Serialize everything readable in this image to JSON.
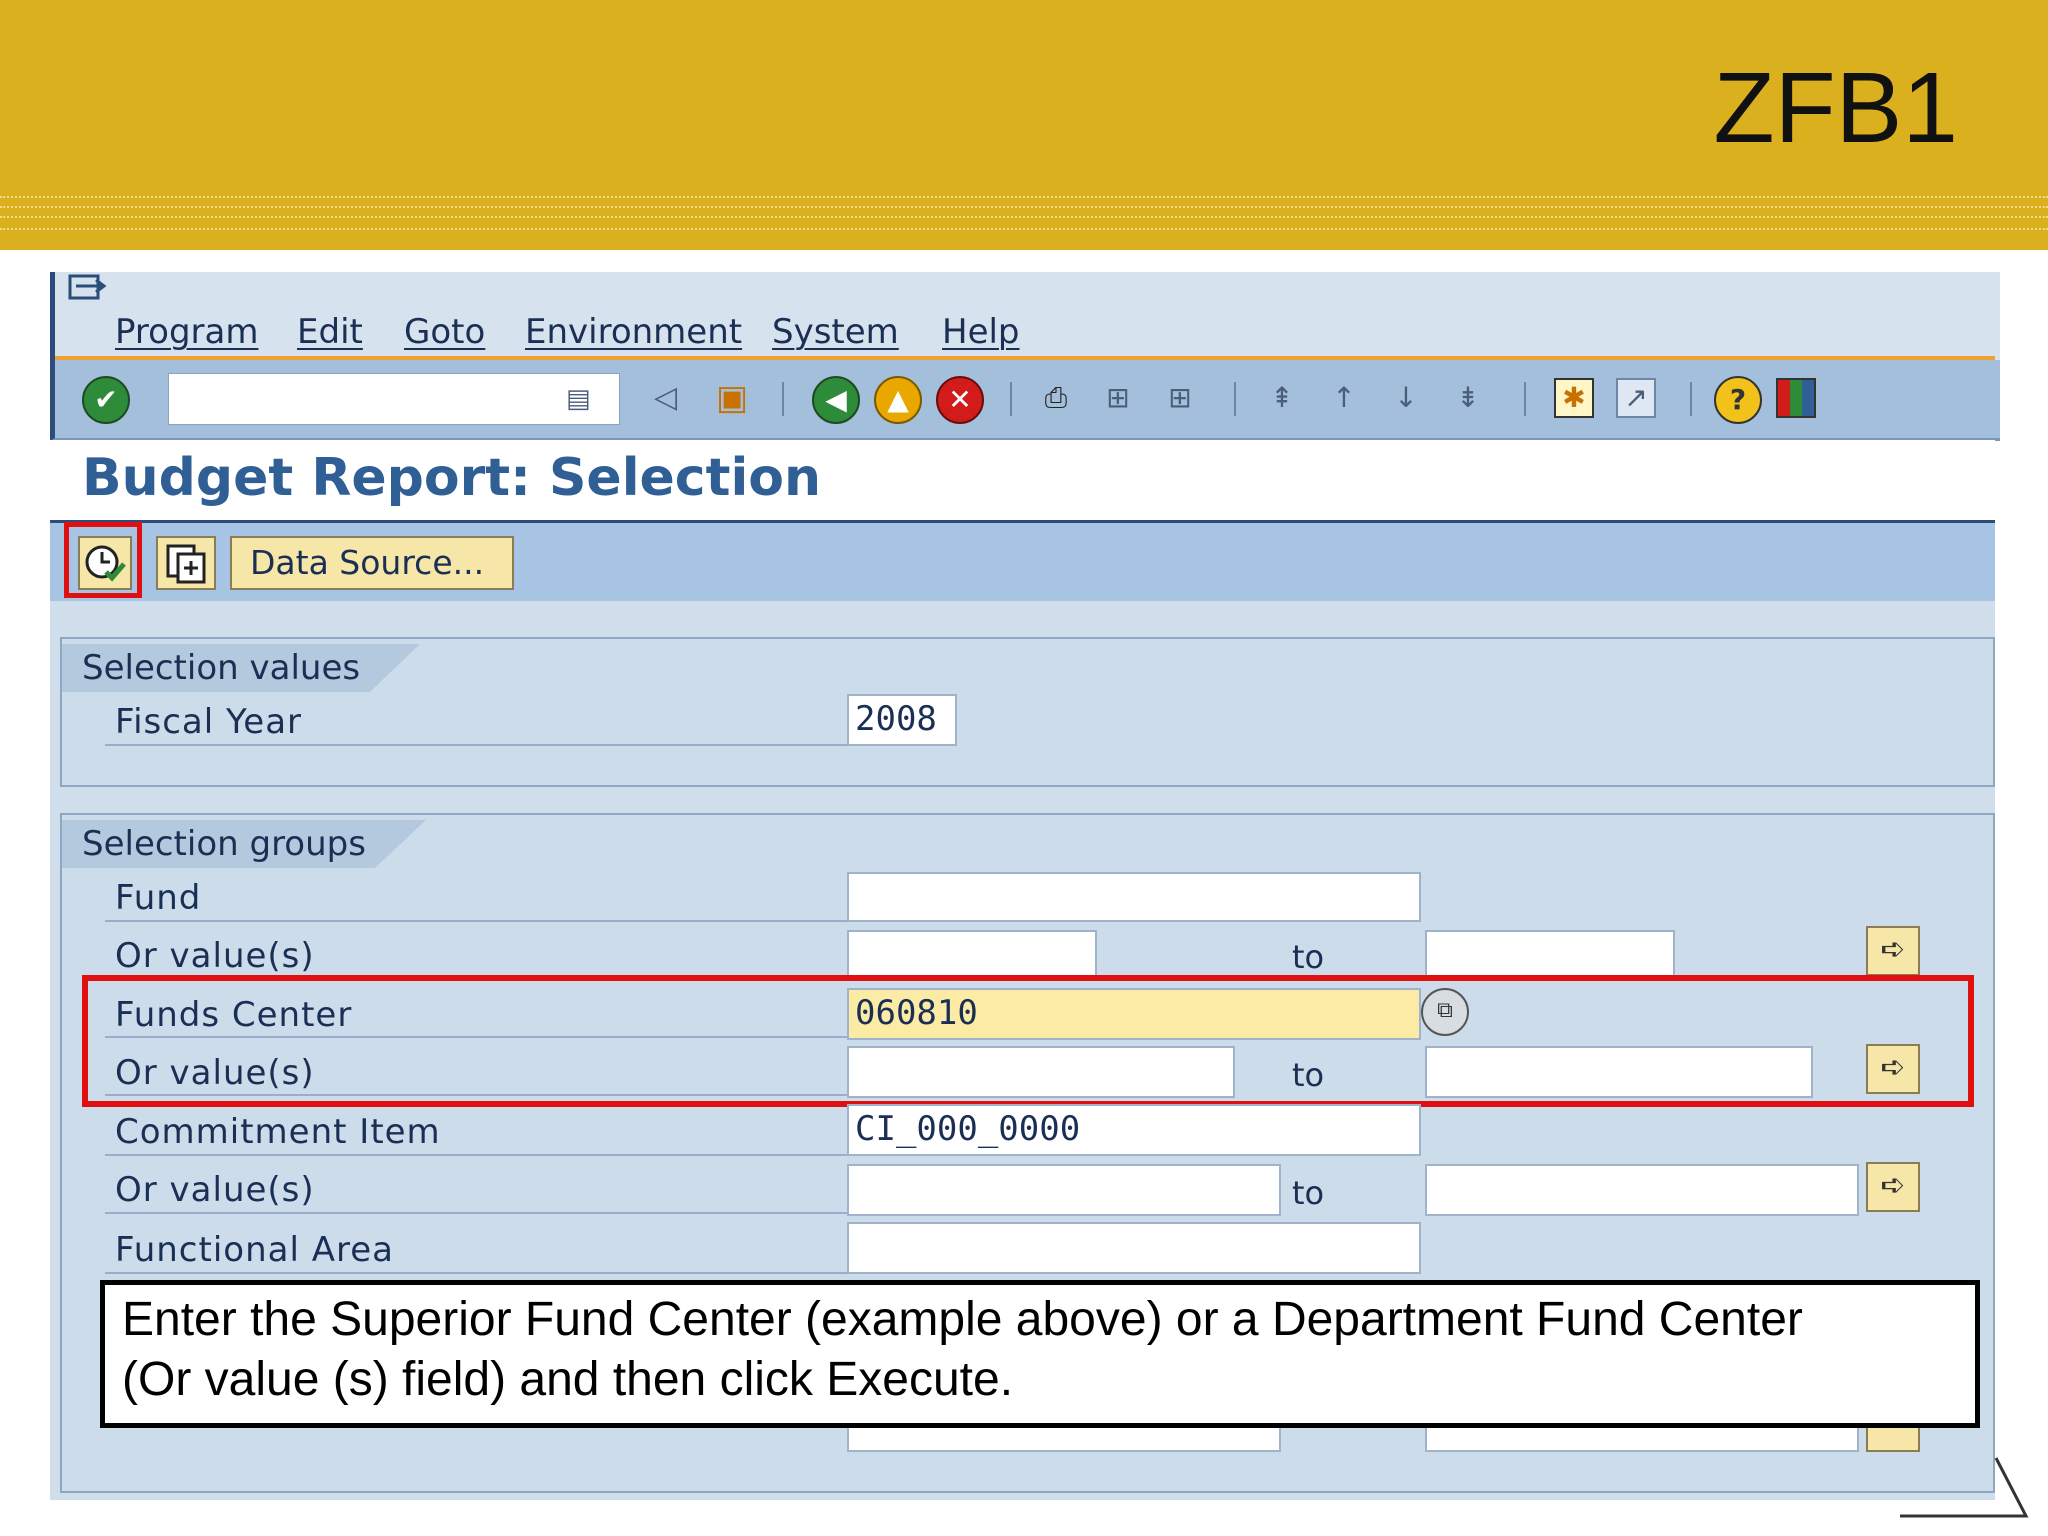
{
  "slide": {
    "title": "ZFB1"
  },
  "menu": {
    "items": [
      {
        "label": "Program"
      },
      {
        "label": "Edit"
      },
      {
        "label": "Goto"
      },
      {
        "label": "Environment"
      },
      {
        "label": "System"
      },
      {
        "label": "Help"
      }
    ]
  },
  "toolbar": {
    "command_field": {
      "value": "",
      "placeholder": ""
    },
    "icons": [
      "enter-icon",
      "back-icon",
      "exit-icon",
      "cancel-icon",
      "print-icon",
      "find-icon",
      "find-next-icon",
      "first-page-icon",
      "previous-page-icon",
      "next-page-icon",
      "last-page-icon",
      "new-session-icon",
      "shortcut-icon",
      "help-icon",
      "layout-icon"
    ]
  },
  "page": {
    "title": "Budget Report: Selection"
  },
  "app_toolbar": {
    "execute_icon": "execute-icon",
    "variant_icon": "get-variant-icon",
    "data_source_label": "Data Source..."
  },
  "selection_values": {
    "title": "Selection values",
    "fiscal_year": {
      "label": "Fiscal Year",
      "value": "2008"
    }
  },
  "selection_groups": {
    "title": "Selection groups",
    "fund": {
      "label": "Fund",
      "value": ""
    },
    "fund_or": {
      "label": "Or value(s)",
      "from": "",
      "to_label": "to",
      "to": ""
    },
    "funds_center": {
      "label": "Funds Center",
      "value": "060810"
    },
    "funds_center_or": {
      "label": "Or value(s)",
      "from": "",
      "to_label": "to",
      "to": ""
    },
    "commitment_item": {
      "label": "Commitment Item",
      "value": "CI_000_0000"
    },
    "commitment_or": {
      "label": "Or value(s)",
      "from": "",
      "to_label": "to",
      "to": ""
    },
    "functional_area": {
      "label": "Functional Area",
      "value": ""
    }
  },
  "callout": {
    "line1": "Enter the Superior Fund Center (example above) or a Department Fund Center",
    "line2": "(Or value (s) field) and then click Execute."
  },
  "colors": {
    "banner": "#dbb01f",
    "highlight": "#e01010",
    "sap_blue": "#a8c4e4",
    "title_blue": "#2f5f94"
  }
}
